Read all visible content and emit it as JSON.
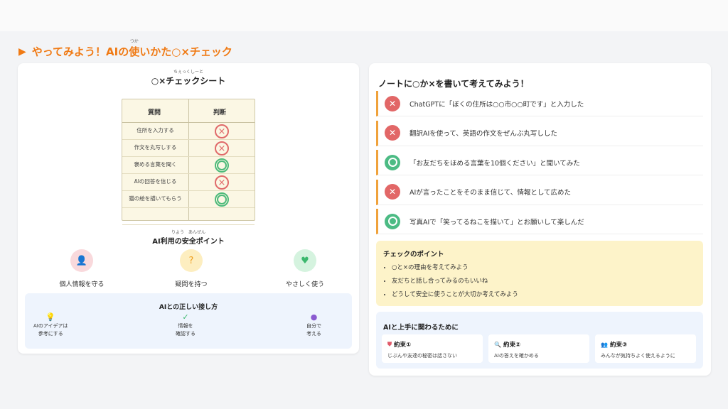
{
  "title": {
    "prefix": "やってみよう！AIの",
    "kanji": "使",
    "kanji_ruby": "つか",
    "suffix": "いかた○×チェック"
  },
  "left": {
    "sheet_title": "○×チェックシート",
    "sheet_title_ruby": "ちぇっくしーと",
    "headers": {
      "question": "質問",
      "judgment": "判断"
    },
    "rows": [
      {
        "question": "住所を入力する",
        "mark": "x"
      },
      {
        "question": "作文を丸写しする",
        "mark": "x"
      },
      {
        "question": "褒める言葉を聞く",
        "mark": "o"
      },
      {
        "question": "AIの回答を信じる",
        "mark": "x"
      },
      {
        "question": "猫の絵を描いてもらう",
        "mark": "o"
      }
    ],
    "safety_title": "AI利用の安全ポイント",
    "safety_title_ruby": "りよう　あんぜん",
    "safety_items": [
      {
        "label": "個人情報を守る",
        "icon": "person-shield-icon",
        "color": "#f9d9dc",
        "icon_color": "#e05a6a",
        "glyph": "👤"
      },
      {
        "label": "疑問を持つ",
        "icon": "question-icon",
        "color": "#fdeec0",
        "icon_color": "#f0a020",
        "glyph": "?"
      },
      {
        "label": "やさしく使う",
        "icon": "heart-icon",
        "color": "#d5f3df",
        "icon_color": "#3cb86e",
        "glyph": "♥"
      }
    ],
    "relation_title": "AIとの正しい接し方",
    "relation_items": [
      {
        "line1": "AIのアイデアは",
        "line2": "参考にする",
        "icon": "lightbulb-icon",
        "glyph": "💡"
      },
      {
        "line1": "情報を",
        "line2": "確認する",
        "icon": "check-icon",
        "glyph": "✓"
      },
      {
        "line1": "自分で",
        "line2": "考える",
        "icon": "brain-icon",
        "glyph": "●"
      }
    ]
  },
  "right": {
    "title": "ノートに○か×を書いて考えてみよう！",
    "cases": [
      {
        "text": "ChatGPTに「ぼくの住所は○○市○○町です」と入力した",
        "mark": "x"
      },
      {
        "text": "翻訳AIを使って、英語の作文をぜんぶ丸写しした",
        "mark": "x"
      },
      {
        "text": "「お友だちをほめる言葉を10個ください」と聞いてみた",
        "mark": "o"
      },
      {
        "text": "AIが言ったことをそのまま信じて、情報として広めた",
        "mark": "x"
      },
      {
        "text": "写真AIで「笑ってるねこを描いて」とお願いして楽しんだ",
        "mark": "o"
      }
    ],
    "points_title": "チェックのポイント",
    "points": [
      "○と×の理由を考えてみよう",
      "友だちと話し合ってみるのもいいね",
      "どうして安全に使うことが大切か考えてみよう"
    ],
    "promise_title": "AIと上手に関わるために",
    "promises": [
      {
        "title": "約束①",
        "text": "じぶんや友達の秘密は話さない",
        "icon": "shield-icon",
        "glyph": "⛊",
        "icon_color": "#e05a6a"
      },
      {
        "title": "約束②",
        "text": "AIの答えを確かめる",
        "icon": "search-icon",
        "glyph": "🔍",
        "icon_color": "#3a7bd5"
      },
      {
        "title": "約束③",
        "text": "みんなが気持ちよく使えるように",
        "icon": "people-icon",
        "glyph": "👥",
        "icon_color": "#3cb86e"
      }
    ]
  }
}
